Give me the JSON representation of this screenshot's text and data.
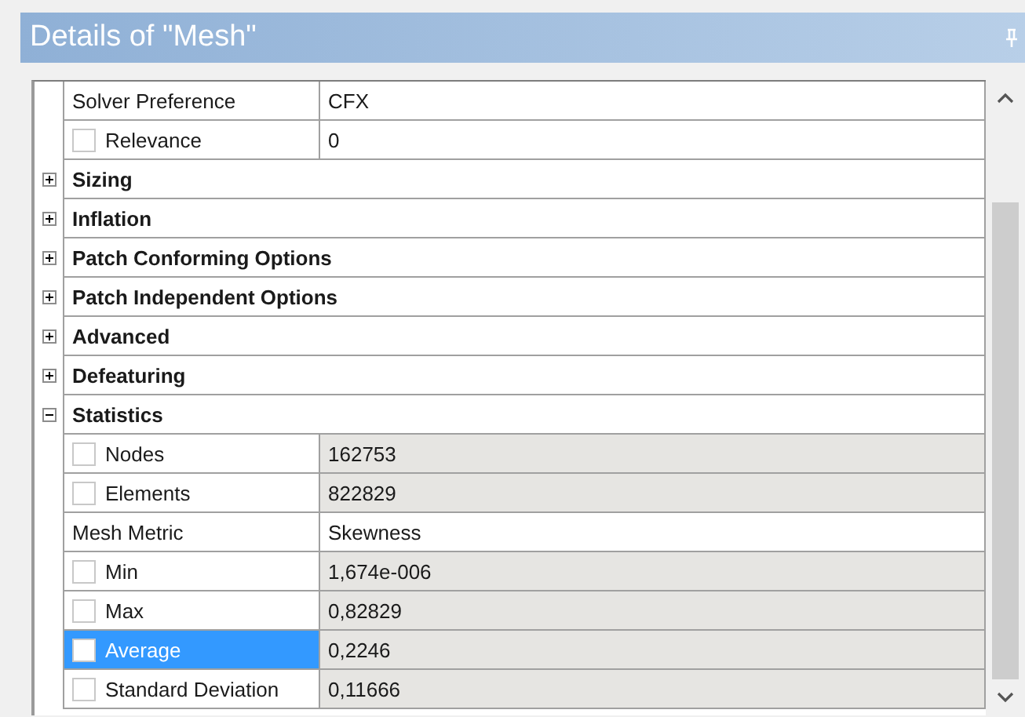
{
  "panel": {
    "title": "Details of \"Mesh\""
  },
  "rows": [
    {
      "kind": "property",
      "label": "Solver Preference",
      "value": "CFX",
      "readonly": false,
      "selected": false
    },
    {
      "kind": "check_property",
      "label": "Relevance",
      "value": "0",
      "checked": false,
      "readonly": false,
      "selected": false
    },
    {
      "kind": "group",
      "label": "Sizing",
      "expanded": false
    },
    {
      "kind": "group",
      "label": "Inflation",
      "expanded": false
    },
    {
      "kind": "group",
      "label": "Patch Conforming Options",
      "expanded": false
    },
    {
      "kind": "group",
      "label": "Patch Independent Options",
      "expanded": false
    },
    {
      "kind": "group",
      "label": "Advanced",
      "expanded": false
    },
    {
      "kind": "group",
      "label": "Defeaturing",
      "expanded": false
    },
    {
      "kind": "group",
      "label": "Statistics",
      "expanded": true
    },
    {
      "kind": "check_property",
      "label": "Nodes",
      "value": "162753",
      "checked": false,
      "readonly": true,
      "selected": false
    },
    {
      "kind": "check_property",
      "label": "Elements",
      "value": "822829",
      "checked": false,
      "readonly": true,
      "selected": false
    },
    {
      "kind": "property",
      "label": "Mesh Metric",
      "value": "Skewness",
      "readonly": false,
      "selected": false
    },
    {
      "kind": "check_property",
      "label": "Min",
      "value": "1,674e-006",
      "checked": false,
      "readonly": true,
      "selected": false
    },
    {
      "kind": "check_property",
      "label": "Max",
      "value": "0,82829",
      "checked": false,
      "readonly": true,
      "selected": false
    },
    {
      "kind": "check_property",
      "label": "Average",
      "value": "0,2246",
      "checked": false,
      "readonly": true,
      "selected": true
    },
    {
      "kind": "check_property",
      "label": "Standard Deviation",
      "value": "0,11666",
      "checked": false,
      "readonly": true,
      "selected": false
    }
  ]
}
